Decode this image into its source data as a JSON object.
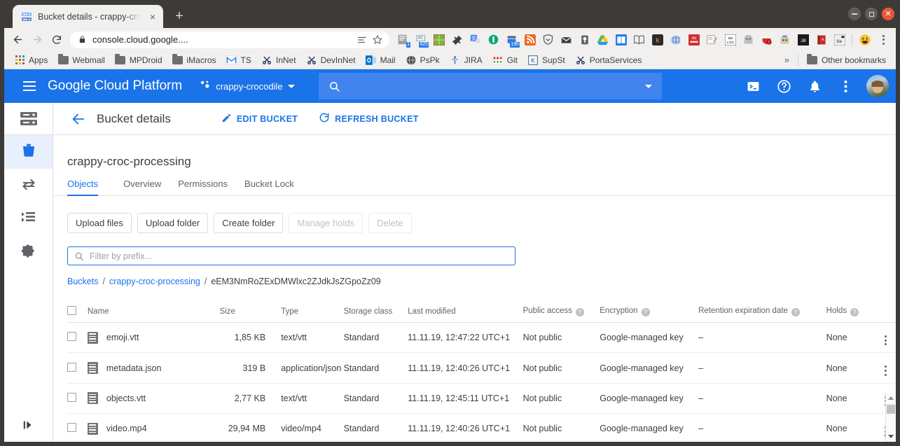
{
  "browser": {
    "tab": {
      "title": "Bucket details - crappy-croco",
      "favicon": "storage-bucket-icon",
      "close": "×"
    },
    "new_tab_label": "+",
    "window_controls": {
      "minimize": "minimize",
      "maximize": "maximize",
      "close": "×"
    },
    "omnibox": {
      "url": "console.cloud.google....",
      "lock": "lock-icon"
    },
    "nav": {
      "back": "←",
      "forward": "→",
      "reload": "⟳"
    },
    "extensions": [
      {
        "name": "reader-extension-icon",
        "badge": "1"
      },
      {
        "name": "print-preview-extension-icon",
        "badge": "425"
      },
      {
        "name": "green-grid-extension-icon",
        "badge": ""
      },
      {
        "name": "pushpin-extension-icon",
        "badge": ""
      },
      {
        "name": "translate-extension-icon",
        "badge": ""
      },
      {
        "name": "pocket-extension-icon",
        "badge": ""
      },
      {
        "name": "time-tracker-extension-icon",
        "badge": "19h"
      },
      {
        "name": "rss-feed-extension-icon",
        "badge": ""
      },
      {
        "name": "shield-extension-icon",
        "badge": ""
      },
      {
        "name": "mail-envelope-extension-icon",
        "badge": ""
      },
      {
        "name": "lightbulb-extension-icon",
        "badge": ""
      },
      {
        "name": "google-drive-extension-icon",
        "badge": ""
      },
      {
        "name": "dictionary-extension-icon",
        "badge": ""
      },
      {
        "name": "book-extension-icon",
        "badge": ""
      },
      {
        "name": "kodi-extension-icon",
        "badge": ""
      },
      {
        "name": "globe-extension-icon",
        "badge": ""
      },
      {
        "name": "adblock-extension-icon",
        "badge": ""
      },
      {
        "name": "notes-extension-icon",
        "badge": ""
      },
      {
        "name": "bblog-extension-icon",
        "badge": ""
      },
      {
        "name": "ghost-extension-icon",
        "badge": ""
      },
      {
        "name": "privacy-badger-extension-icon",
        "badge": ""
      },
      {
        "name": "robot-extension-icon",
        "badge": ""
      },
      {
        "name": "jetbrains-extension-icon",
        "badge": ""
      },
      {
        "name": "red-book-extension-icon",
        "badge": ""
      },
      {
        "name": "selenium-extension-icon",
        "badge": ""
      },
      {
        "name": "emoji-extension-icon",
        "badge": ""
      }
    ],
    "bookmarks": [
      {
        "label": "Apps",
        "icon": "apps-grid-icon"
      },
      {
        "label": "Webmail",
        "icon": "folder-icon"
      },
      {
        "label": "MPDroid",
        "icon": "folder-icon"
      },
      {
        "label": "iMacros",
        "icon": "folder-icon"
      },
      {
        "label": "TS",
        "icon": "gmail-m-icon"
      },
      {
        "label": "InNet",
        "icon": "scissors-icon"
      },
      {
        "label": "DevInNet",
        "icon": "scissors-icon"
      },
      {
        "label": "Mail",
        "icon": "outlook-icon"
      },
      {
        "label": "PsPk",
        "icon": "globe-icon"
      },
      {
        "label": "JIRA",
        "icon": "jira-icon"
      },
      {
        "label": "Git",
        "icon": "git-icon"
      },
      {
        "label": "SupSt",
        "icon": "k-square-icon"
      },
      {
        "label": "PortaServices",
        "icon": "scissors-icon"
      }
    ],
    "bookmarks_overflow": "»",
    "other_bookmarks": {
      "label": "Other bookmarks",
      "icon": "folder-icon"
    }
  },
  "gcp_header": {
    "menu": "hamburger-menu-icon",
    "logo": "Google Cloud Platform",
    "project": "crappy-crocodile",
    "project_icon": "project-dots-icon",
    "search_placeholder": "",
    "search_value": "",
    "icons": [
      "cloud-shell-icon",
      "help-icon",
      "notifications-bell-icon",
      "more-vert-icon"
    ],
    "avatar": "user-avatar"
  },
  "rail": {
    "top_icon": "storage-browser-icon",
    "items": [
      {
        "icon": "bucket-icon",
        "name": "browser",
        "active": true
      },
      {
        "icon": "transfer-icon",
        "name": "transfer",
        "active": false
      },
      {
        "icon": "transfer-jobs-icon",
        "name": "transfer-jobs",
        "active": false
      },
      {
        "icon": "settings-gear-icon",
        "name": "settings",
        "active": false
      }
    ],
    "expand_icon": "expand-panel-icon"
  },
  "page_header": {
    "back": "back-arrow-icon",
    "title": "Bucket details",
    "actions": [
      {
        "label": "EDIT BUCKET",
        "icon": "pencil-icon"
      },
      {
        "label": "REFRESH BUCKET",
        "icon": "refresh-icon"
      }
    ]
  },
  "bucket": {
    "name": "crappy-croc-processing",
    "tabs": [
      {
        "label": "Objects",
        "active": true
      },
      {
        "label": "Overview",
        "active": false
      },
      {
        "label": "Permissions",
        "active": false
      },
      {
        "label": "Bucket Lock",
        "active": false
      }
    ]
  },
  "toolbar_buttons": [
    {
      "label": "Upload files",
      "disabled": false
    },
    {
      "label": "Upload folder",
      "disabled": false
    },
    {
      "label": "Create folder",
      "disabled": false
    },
    {
      "label": "Manage holds",
      "disabled": true
    },
    {
      "label": "Delete",
      "disabled": true
    }
  ],
  "filter": {
    "placeholder": "Filter by prefix...",
    "value": "",
    "icon": "search-icon"
  },
  "breadcrumb": {
    "root": "Buckets",
    "bucket": "crappy-croc-processing",
    "current": "eEM3NmRoZExDMWlxc2ZJdkJsZGpoZz09",
    "separator": "/"
  },
  "table": {
    "columns": [
      {
        "label": "Name",
        "help": false
      },
      {
        "label": "Size",
        "help": false
      },
      {
        "label": "Type",
        "help": false
      },
      {
        "label": "Storage class",
        "help": false
      },
      {
        "label": "Last modified",
        "help": false
      },
      {
        "label": "Public access",
        "help": true
      },
      {
        "label": "Encryption",
        "help": true
      },
      {
        "label": "Retention expiration date",
        "help": true
      },
      {
        "label": "Holds",
        "help": true
      }
    ],
    "help_glyph": "?",
    "rows": [
      {
        "name": "emoji.vtt",
        "size": "1,85 KB",
        "type": "text/vtt",
        "storage_class": "Standard",
        "last_modified": "11.11.19, 12:47:22 UTC+1",
        "public_access": "Not public",
        "encryption": "Google-managed key",
        "retention": "–",
        "holds": "None"
      },
      {
        "name": "metadata.json",
        "size": "319 B",
        "type": "application/json",
        "storage_class": "Standard",
        "last_modified": "11.11.19, 12:40:26 UTC+1",
        "public_access": "Not public",
        "encryption": "Google-managed key",
        "retention": "–",
        "holds": "None"
      },
      {
        "name": "objects.vtt",
        "size": "2,77 KB",
        "type": "text/vtt",
        "storage_class": "Standard",
        "last_modified": "11.11.19, 12:45:11 UTC+1",
        "public_access": "Not public",
        "encryption": "Google-managed key",
        "retention": "–",
        "holds": "None"
      },
      {
        "name": "video.mp4",
        "size": "29,94 MB",
        "type": "video/mp4",
        "storage_class": "Standard",
        "last_modified": "11.11.19, 12:40:26 UTC+1",
        "public_access": "Not public",
        "encryption": "Google-managed key",
        "retention": "–",
        "holds": "None"
      }
    ]
  },
  "colors": {
    "accent": "#1a73e8",
    "header_bg": "#1a73e8",
    "rail_active_bg": "#e8f0fe",
    "text": "#3c4043",
    "muted": "#5f6368"
  }
}
